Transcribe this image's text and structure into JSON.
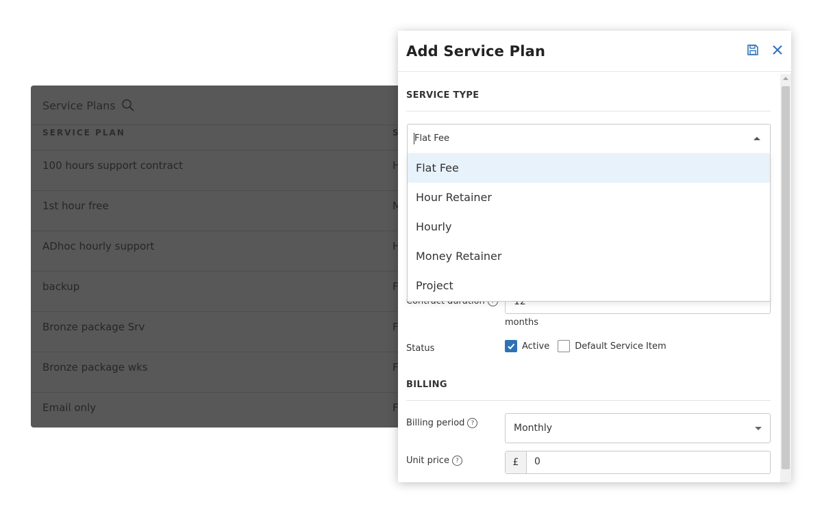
{
  "background_list": {
    "title": "Service Plans",
    "column_header": "SERVICE PLAN",
    "rows": [
      {
        "name": "100 hours support contract",
        "type_initial": "H"
      },
      {
        "name": "1st hour free",
        "type_initial": "M"
      },
      {
        "name": "ADhoc hourly support",
        "type_initial": "H"
      },
      {
        "name": "backup",
        "type_initial": "F"
      },
      {
        "name": "Bronze package Srv",
        "type_initial": "F"
      },
      {
        "name": "Bronze package wks",
        "type_initial": "F"
      },
      {
        "name": "Email only",
        "type_initial": "F"
      }
    ],
    "column2_header_initial": "S"
  },
  "modal": {
    "title": "Add Service Plan",
    "service_type": {
      "section_label": "SERVICE TYPE",
      "selected_value": "Flat Fee",
      "options": [
        "Flat Fee",
        "Hour Retainer",
        "Hourly",
        "Money Retainer",
        "Project"
      ]
    },
    "contract_duration": {
      "label": "Contract duration",
      "value": "12",
      "unit": "months"
    },
    "status": {
      "label": "Status",
      "active_label": "Active",
      "active_checked": true,
      "default_label": "Default Service Item",
      "default_checked": false
    },
    "billing": {
      "section_label": "BILLING",
      "billing_period_label": "Billing period",
      "billing_period_value": "Monthly",
      "unit_price_label": "Unit price",
      "currency_symbol": "£",
      "unit_price_value": "0"
    }
  },
  "colors": {
    "accent": "#2f71b6",
    "selected_option_bg": "#e8f2fb",
    "overlay": "#585858"
  }
}
